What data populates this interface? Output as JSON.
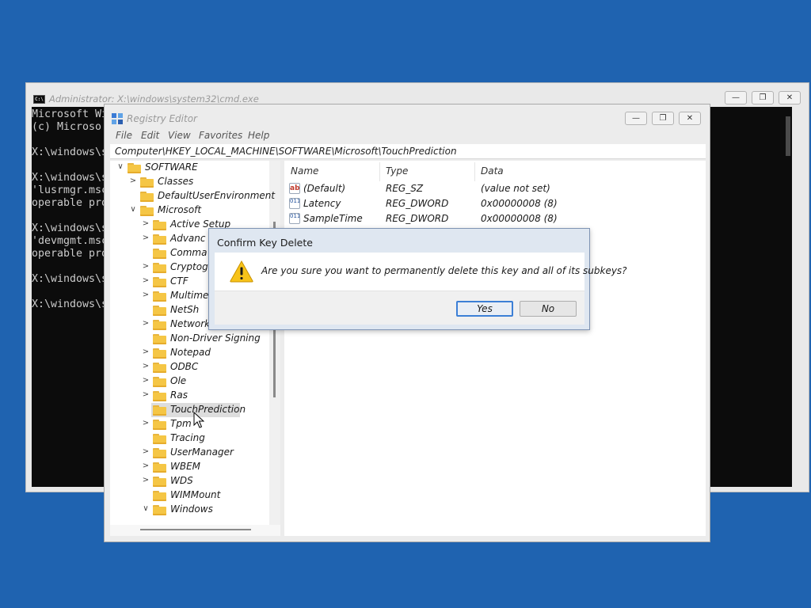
{
  "cmd": {
    "title": "Administrator: X:\\windows\\system32\\cmd.exe",
    "icon_label": "C:\\",
    "minimize": "—",
    "maximize": "❐",
    "close": "✕",
    "console_lines": [
      "Microsoft Wi",
      "(c) Microso",
      "",
      "X:\\windows\\s",
      "",
      "X:\\windows\\s",
      "'lusrmgr.msc",
      "operable pro",
      "",
      "X:\\windows\\s",
      "'devmgmt.msc",
      "operable pro",
      "",
      "X:\\windows\\s",
      "",
      "X:\\windows\\s"
    ]
  },
  "regedit": {
    "title": "Registry Editor",
    "minimize": "—",
    "maximize": "❐",
    "close": "✕",
    "menu": [
      "File",
      "Edit",
      "View",
      "Favorites",
      "Help"
    ],
    "address": "Computer\\HKEY_LOCAL_MACHINE\\SOFTWARE\\Microsoft\\TouchPrediction",
    "tree": [
      {
        "label": "SOFTWARE",
        "chevron": "∨"
      },
      {
        "label": "Classes",
        "chevron": ">"
      },
      {
        "label": "DefaultUserEnvironment",
        "chevron": ""
      },
      {
        "label": "Microsoft",
        "chevron": "∨"
      },
      {
        "label": "Active Setup",
        "chevron": ">"
      },
      {
        "label": "Advanc",
        "chevron": ">"
      },
      {
        "label": "Comma",
        "chevron": ""
      },
      {
        "label": "Cryptog",
        "chevron": ">"
      },
      {
        "label": "CTF",
        "chevron": ">"
      },
      {
        "label": "Multime",
        "chevron": ">"
      },
      {
        "label": "NetSh",
        "chevron": ""
      },
      {
        "label": "Network",
        "chevron": ">"
      },
      {
        "label": "Non-Driver Signing",
        "chevron": ""
      },
      {
        "label": "Notepad",
        "chevron": ">"
      },
      {
        "label": "ODBC",
        "chevron": ">"
      },
      {
        "label": "Ole",
        "chevron": ">"
      },
      {
        "label": "Ras",
        "chevron": ">"
      },
      {
        "label": "TouchPrediction",
        "chevron": "",
        "selected": true
      },
      {
        "label": "Tpm",
        "chevron": ">"
      },
      {
        "label": "Tracing",
        "chevron": ""
      },
      {
        "label": "UserManager",
        "chevron": ">"
      },
      {
        "label": "WBEM",
        "chevron": ">"
      },
      {
        "label": "WDS",
        "chevron": ">"
      },
      {
        "label": "WIMMount",
        "chevron": ""
      },
      {
        "label": "Windows",
        "chevron": "∨"
      }
    ],
    "columns": {
      "name": "Name",
      "type": "Type",
      "data": "Data"
    },
    "values": [
      {
        "icon": "ab",
        "name": "(Default)",
        "type": "REG_SZ",
        "data": "(value not set)"
      },
      {
        "icon": "011",
        "name": "Latency",
        "type": "REG_DWORD",
        "data": "0x00000008 (8)"
      },
      {
        "icon": "011",
        "name": "SampleTime",
        "type": "REG_DWORD",
        "data": "0x00000008 (8)"
      }
    ]
  },
  "dialog": {
    "title": "Confirm Key Delete",
    "message": "Are you sure you want to permanently delete this key and all of its subkeys?",
    "yes": "Yes",
    "no": "No"
  },
  "colors": {
    "desktop": "#1f63b0",
    "console_bg": "#0c0c0c",
    "folder": "#f5c645",
    "default_button_border": "#3c7fd6"
  }
}
